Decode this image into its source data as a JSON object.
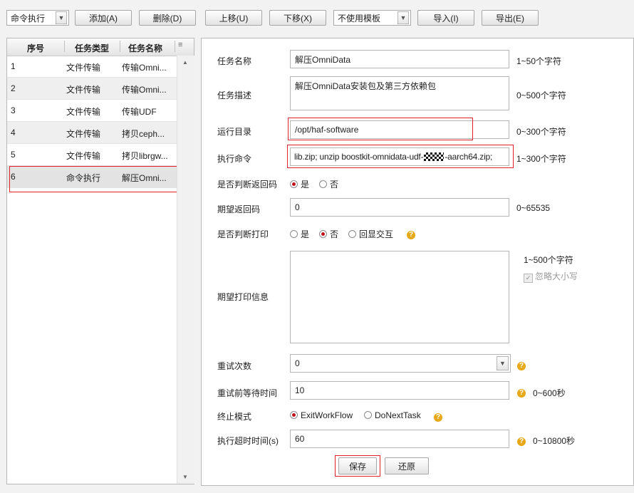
{
  "toolbar": {
    "type_select": "命令执行",
    "add": "添加(A)",
    "delete": "删除(D)",
    "move_up": "上移(U)",
    "move_down": "下移(X)",
    "template_select": "不使用模板",
    "import": "导入(I)",
    "export": "导出(E)"
  },
  "task_list": {
    "headers": [
      "序号",
      "任务类型",
      "任务名称"
    ],
    "rows": [
      {
        "no": "1",
        "type": "文件传输",
        "name": "传输Omni..."
      },
      {
        "no": "2",
        "type": "文件传输",
        "name": "传输Omni..."
      },
      {
        "no": "3",
        "type": "文件传输",
        "name": "传输UDF"
      },
      {
        "no": "4",
        "type": "文件传输",
        "name": "拷贝ceph..."
      },
      {
        "no": "5",
        "type": "文件传输",
        "name": "拷贝librgw..."
      },
      {
        "no": "6",
        "type": "命令执行",
        "name": "解压Omni..."
      }
    ],
    "selected_index": 5
  },
  "form": {
    "task_name": {
      "label": "任务名称",
      "value": "解压OmniData",
      "hint": "1~50个字符"
    },
    "task_desc": {
      "label": "任务描述",
      "value": "解压OmniData安装包及第三方依赖包",
      "hint": "0~500个字符"
    },
    "run_dir": {
      "label": "运行目录",
      "value": "/opt/haf-software",
      "hint": "0~300个字符"
    },
    "command": {
      "label": "执行命令",
      "value_before": "lib.zip; unzip boostkit-omnidata-udf-",
      "value_after": "-aarch64.zip;",
      "hint": "1~300个字符"
    },
    "check_return": {
      "label": "是否判断返回码",
      "options": [
        "是",
        "否"
      ],
      "selected": "是"
    },
    "expected_return": {
      "label": "期望返回码",
      "value": "0",
      "hint": "0~65535"
    },
    "check_print": {
      "label": "是否判断打印",
      "options": [
        "是",
        "否",
        "回显交互"
      ],
      "selected": "否"
    },
    "expected_print": {
      "label": "期望打印信息",
      "value": "",
      "hint": "1~500个字符",
      "ignore_case": "忽略大小写"
    },
    "retry_count": {
      "label": "重试次数",
      "value": "0"
    },
    "retry_wait": {
      "label": "重试前等待时间",
      "value": "10",
      "hint": "0~600秒"
    },
    "stop_mode": {
      "label": "终止模式",
      "options": [
        "ExitWorkFlow",
        "DoNextTask"
      ],
      "selected": "ExitWorkFlow"
    },
    "timeout": {
      "label": "执行超时时间(s)",
      "value": "60",
      "hint": "0~10800秒"
    }
  },
  "actions": {
    "save": "保存",
    "reset": "还原"
  },
  "colors": {
    "highlight": "#e0202a",
    "radio_on": "#c0131a",
    "help": "#e6a817"
  }
}
